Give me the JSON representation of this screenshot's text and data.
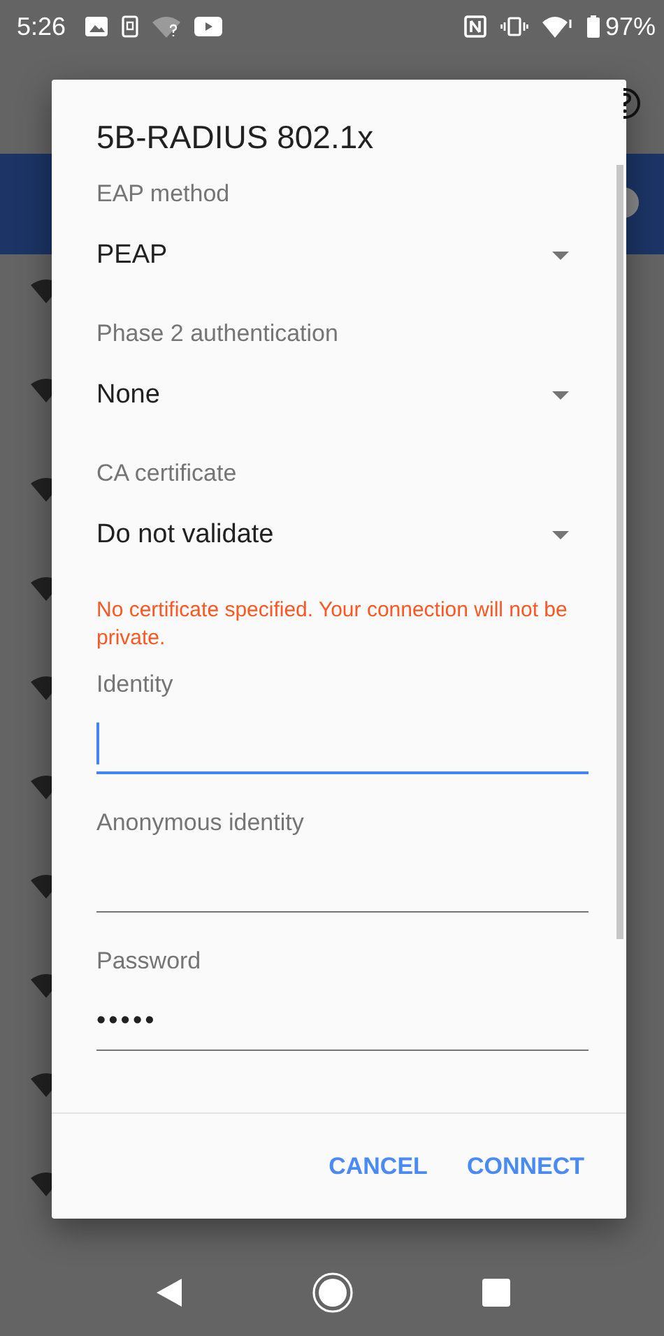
{
  "status_bar": {
    "time": "5:26",
    "battery": "97%"
  },
  "dialog": {
    "title": "5B-RADIUS 802.1x",
    "items": [
      {
        "kind": "dropdown",
        "label": "EAP method",
        "value": "PEAP"
      },
      {
        "kind": "dropdown",
        "label": "Phase 2 authentication",
        "value": "None"
      },
      {
        "kind": "dropdown",
        "label": "CA certificate",
        "value": "Do not validate"
      },
      {
        "kind": "warning",
        "text": "No certificate specified. Your connection will not be private."
      },
      {
        "kind": "field",
        "label": "Identity",
        "focused": true
      },
      {
        "kind": "field",
        "label": "Anonymous identity",
        "focused": false
      },
      {
        "kind": "field",
        "label": "Password",
        "value": "•••••",
        "focused": false
      }
    ],
    "buttons": [
      "CANCEL",
      "CONNECT"
    ]
  }
}
